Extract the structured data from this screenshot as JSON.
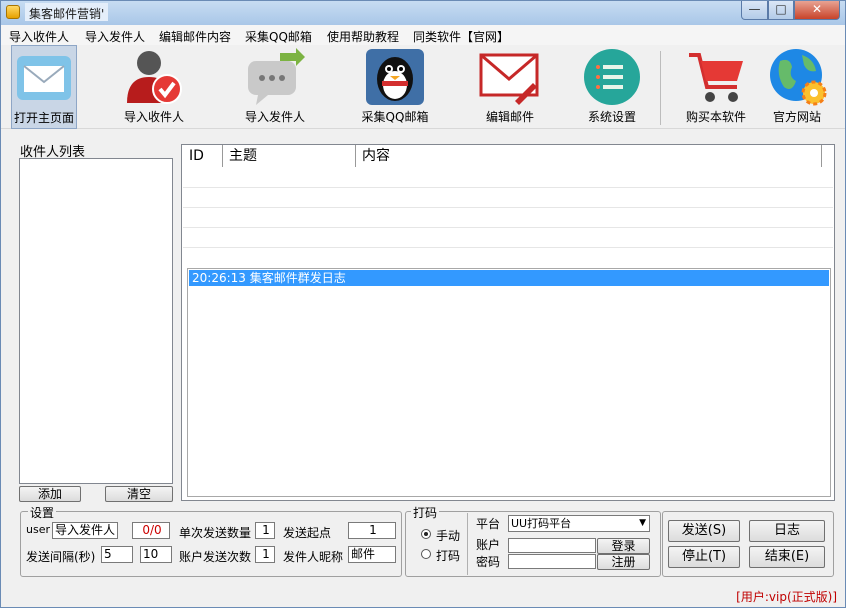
{
  "window": {
    "title": "集客邮件营销'"
  },
  "menu": [
    "导入收件人",
    "导入发件人",
    "编辑邮件内容",
    "采集QQ邮箱",
    "使用帮助教程",
    "同类软件【官网】"
  ],
  "toolbar": [
    {
      "label": "打开主页面",
      "icon": "mail-envelope-icon"
    },
    {
      "label": "导入收件人",
      "icon": "user-check-icon"
    },
    {
      "label": "导入发件人",
      "icon": "chat-arrow-icon"
    },
    {
      "label": "采集QQ邮箱",
      "icon": "qq-penguin-icon"
    },
    {
      "label": "编辑邮件",
      "icon": "mail-edit-icon"
    },
    {
      "label": "系统设置",
      "icon": "settings-list-icon"
    },
    {
      "label": "购买本软件",
      "icon": "shopping-cart-icon"
    },
    {
      "label": "官方网站",
      "icon": "globe-gear-icon"
    }
  ],
  "recipients": {
    "title": "收件人列表",
    "add_label": "添加",
    "clear_label": "清空"
  },
  "grid": {
    "columns": [
      "ID",
      "主题",
      "内容"
    ]
  },
  "log": {
    "entry": "20:26:13 集客邮件群发日志"
  },
  "settings": {
    "title": "设置",
    "user_label": "user",
    "import_sender_value": "导入发件人",
    "counter": "0/0",
    "single_send_label": "单次发送数量",
    "single_send_value": "1",
    "start_point_label": "发送起点",
    "start_point_value": "1",
    "interval_label": "发送间隔(秒)",
    "interval_min": "5",
    "interval_max": "10",
    "account_send_label": "账户发送次数",
    "account_send_value": "1",
    "nickname_label": "发件人昵称",
    "nickname_value": "邮件"
  },
  "captcha": {
    "title": "打码",
    "manual_label": "手动",
    "auto_label": "打码",
    "platform_label": "平台",
    "platform_value": "UU打码平台",
    "account_label": "账户",
    "password_label": "密码",
    "login_label": "登录",
    "register_label": "注册"
  },
  "actions": {
    "send": "发送(S)",
    "log": "日志",
    "stop": "停止(T)",
    "end": "结束(E)"
  },
  "status": {
    "user": "[用户:vip(正式版)]"
  },
  "colors": {
    "accent": "#3399ff",
    "status_text": "#c00000",
    "counter_text": "#cc0000"
  }
}
